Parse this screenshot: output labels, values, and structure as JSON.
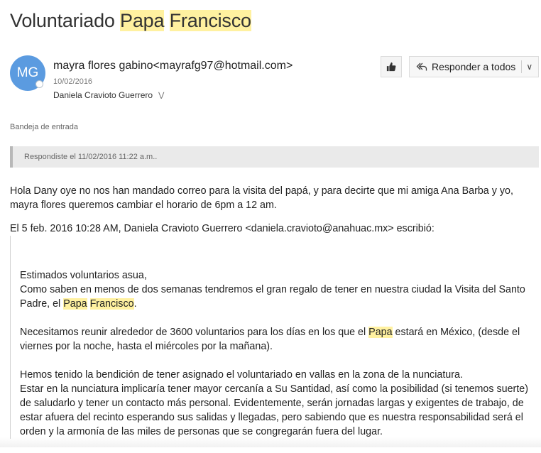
{
  "subject": {
    "pre": "Voluntariado ",
    "hl1": "Papa",
    "sp": " ",
    "hl2": "Francisco"
  },
  "sender": {
    "initials": "MG",
    "name": "mayra flores gabino",
    "email": "<mayrafg97@hotmail.com>",
    "date": "10/02/2016",
    "to": "Daniela Cravioto Guerrero",
    "avatar_color": "#5b9be0"
  },
  "toolbar": {
    "like_icon": "thumbs-up-icon",
    "reply_all_label": "Responder a todos",
    "reply_icon": "reply-all-icon",
    "dropdown_icon": "chevron-down-icon"
  },
  "folder": "Bandeja de entrada",
  "replied_notice": "Respondiste el 11/02/2016 11:22 a.m..",
  "message": {
    "reply": "Hola Dany oye no nos han mandado correo para la visita del papá, y para decirte que mi amiga Ana Barba y yo, mayra flores queremos cambiar el horario de 6pm a 12 am.",
    "quote_header": "El 5 feb. 2016 10:28 AM, Daniela Cravioto Guerrero <daniela.cravioto@anahuac.mx> escribió:",
    "q1": {
      "line1": "Estimados voluntarios asua,",
      "line2a": "Como saben en menos de dos semanas tendremos el gran regalo de tener en nuestra ciudad la Visita del Santo Padre, el ",
      "hl1": "Papa",
      "hl2": "Francisco",
      "end": "."
    },
    "q2": {
      "a": "Necesitamos reunir alrededor de 3600 voluntarios para los días en los que el ",
      "hl": "Papa",
      "b": " estará en México, (desde el viernes por la noche, hasta el miércoles por la mañana)."
    },
    "q3": {
      "line1": "Hemos tenido la bendición de tener asignado el voluntariado en vallas en la zona de la nunciatura.",
      "line2": "Estar en la nunciatura implicaría tener mayor cercanía a Su Santidad, así como la posibilidad (si tenemos suerte) de saludarlo y tener un contacto más personal.  Evidentemente, serán jornadas largas y exigentes de trabajo, de estar afuera del recinto esperando sus salidas y llegadas, pero sabiendo que es nuestra responsabilidad será el orden y la armonía de las miles de personas que se congregarán fuera del lugar."
    }
  },
  "colors": {
    "highlight": "#fff1a0",
    "accent": "#5b9be0"
  }
}
